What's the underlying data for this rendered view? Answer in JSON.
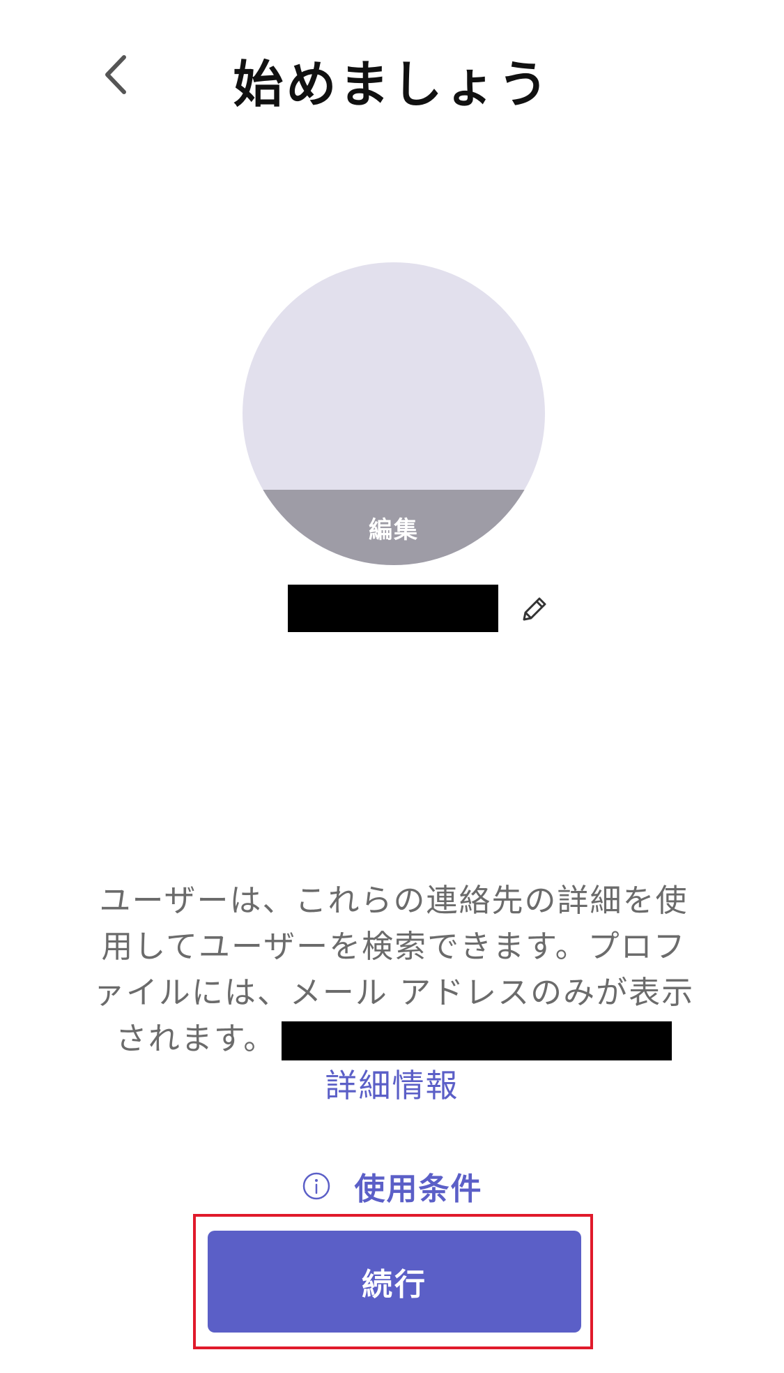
{
  "header": {
    "title": "始めましょう",
    "back_icon": "chevron-left-icon"
  },
  "profile": {
    "avatar_edit_label": "編集",
    "name_value": "[redacted]",
    "edit_name_icon": "pencil-icon"
  },
  "info": {
    "description": "ユーザーは、これらの連絡先の詳細を使用してユーザーを検索できます。プロファイルには、メール アドレスのみが表示されます。",
    "redacted_email": "[redacted]",
    "learn_more_label": "詳細情報"
  },
  "terms": {
    "icon": "info-icon",
    "label": "使用条件"
  },
  "actions": {
    "continue_label": "続行"
  },
  "colors": {
    "accent": "#5b5fc7",
    "avatar_background": "#e2e0ed",
    "avatar_edit_band": "#9e9ca6",
    "highlight": "#e01a2b"
  }
}
